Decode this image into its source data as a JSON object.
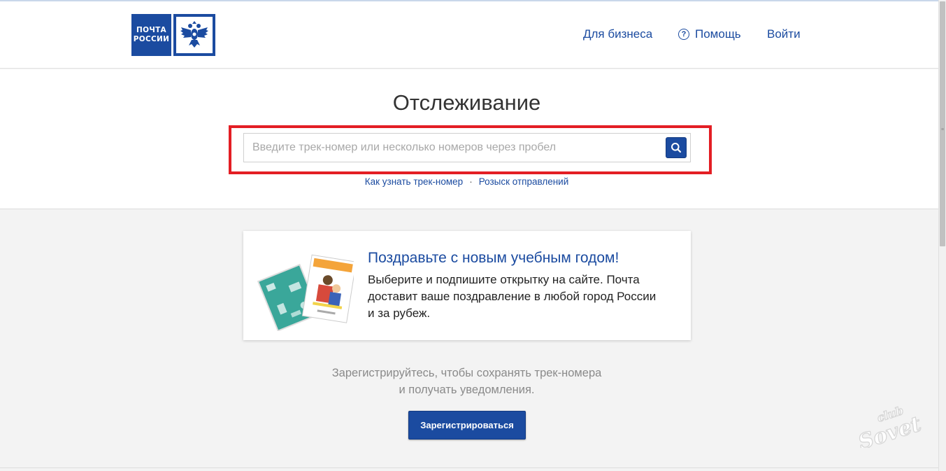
{
  "header": {
    "logo": {
      "line1": "ПОЧТА",
      "line2": "РОССИИ",
      "emblem": "double-headed-eagle-icon"
    },
    "nav": {
      "business": "Для бизнеса",
      "help": "Помощь",
      "help_icon": "?",
      "login": "Войти"
    }
  },
  "tracking": {
    "title": "Отслеживание",
    "search_placeholder": "Введите трек-номер или несколько номеров через пробел",
    "search_value": "",
    "search_icon": "search-icon",
    "links": {
      "how_to_find": "Как узнать трек-номер",
      "separator": "·",
      "search_shipments": "Розыск отправлений"
    }
  },
  "promo": {
    "title": "Поздравьте с новым учебным годом!",
    "text": "Выберите и подпишите открытку на сайте. Почта доставит ваше поздравление в любой город России и за рубеж.",
    "image": "postcards-image"
  },
  "register": {
    "line1": "Зарегистрируйтесь, чтобы сохранять трек-номера",
    "line2": "и получать уведомления.",
    "button": "Зарегистрироваться"
  },
  "watermark": {
    "line1": "club",
    "line2": "Sovet"
  },
  "colors": {
    "brand_blue": "#1b4ba0",
    "highlight_red": "#e31e24",
    "page_bg": "#f3f3f3"
  }
}
